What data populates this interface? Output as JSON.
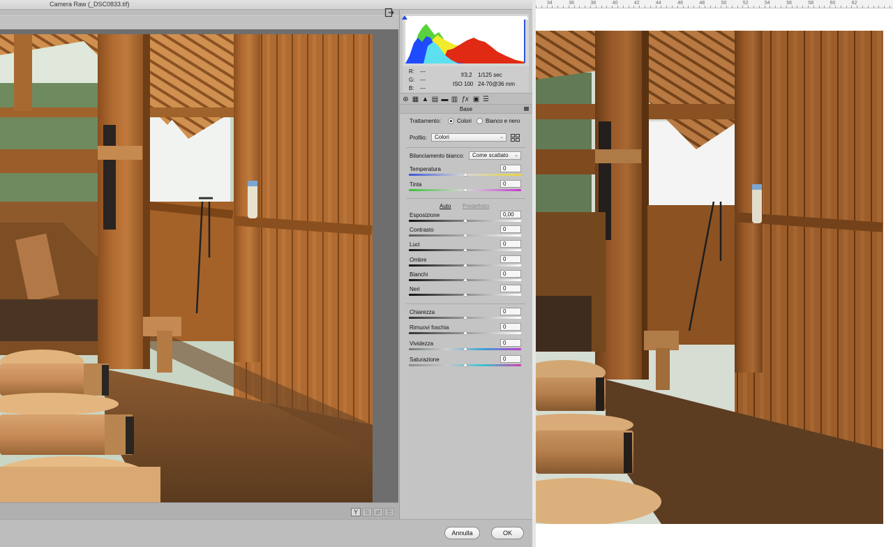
{
  "window": {
    "title": "Camera Raw (_DSC0833.tif)"
  },
  "histogram": {
    "readout": {
      "r_label": "R:",
      "r_value": "---",
      "g_label": "G:",
      "g_value": "---",
      "b_label": "B:",
      "b_value": "---"
    },
    "exif": {
      "aperture": "f/3,2",
      "shutter": "1/125 sec",
      "iso": "ISO 100",
      "lens": "24-70@36 mm"
    }
  },
  "panel": {
    "title": "Base",
    "treatment": {
      "label": "Trattamento:",
      "option_color": "Colori",
      "option_bw": "Bianco e nero",
      "selected": "Colori"
    },
    "profile": {
      "label": "Profilo:",
      "value": "Colori"
    },
    "white_balance": {
      "label": "Bilanciamento bianco:",
      "value": "Come scattato"
    },
    "auto_label": "Auto",
    "default_label": "Predefinito",
    "sliders": [
      {
        "label": "Temperatura",
        "value": "0",
        "level": 0.5
      },
      {
        "label": "Tinta",
        "value": "0",
        "level": 0.5
      },
      {
        "label": "Esposizione",
        "value": "0,00",
        "level": 0.5
      },
      {
        "label": "Contrasto",
        "value": "0",
        "level": 0.5
      },
      {
        "label": "Luci",
        "value": "0",
        "level": 0.5
      },
      {
        "label": "Ombre",
        "value": "0",
        "level": 0.5
      },
      {
        "label": "Bianchi",
        "value": "0",
        "level": 0.5
      },
      {
        "label": "Neri",
        "value": "0",
        "level": 0.5
      },
      {
        "label": "Chiarezza",
        "value": "0",
        "level": 0.5
      },
      {
        "label": "Rimuovi foschia",
        "value": "0",
        "level": 0.5
      },
      {
        "label": "Vividezza",
        "value": "0",
        "level": 0.5
      },
      {
        "label": "Saturazione",
        "value": "0",
        "level": 0.5
      }
    ]
  },
  "preview": {
    "view_toggle_label": "Y"
  },
  "buttons": {
    "cancel": "Annulla",
    "ok": "OK"
  },
  "ruler": {
    "marks": [
      "34",
      "36",
      "38",
      "40",
      "42",
      "44",
      "46",
      "48",
      "50",
      "52",
      "54",
      "56",
      "58",
      "60",
      "62"
    ]
  },
  "colors": {
    "panel_bg": "#c4c4c4",
    "histo_blue": "#1f4bff",
    "histo_cyan": "#5ce0f0",
    "histo_green": "#58d23c",
    "histo_yellow": "#f2ea2a",
    "histo_red": "#e02a14"
  }
}
